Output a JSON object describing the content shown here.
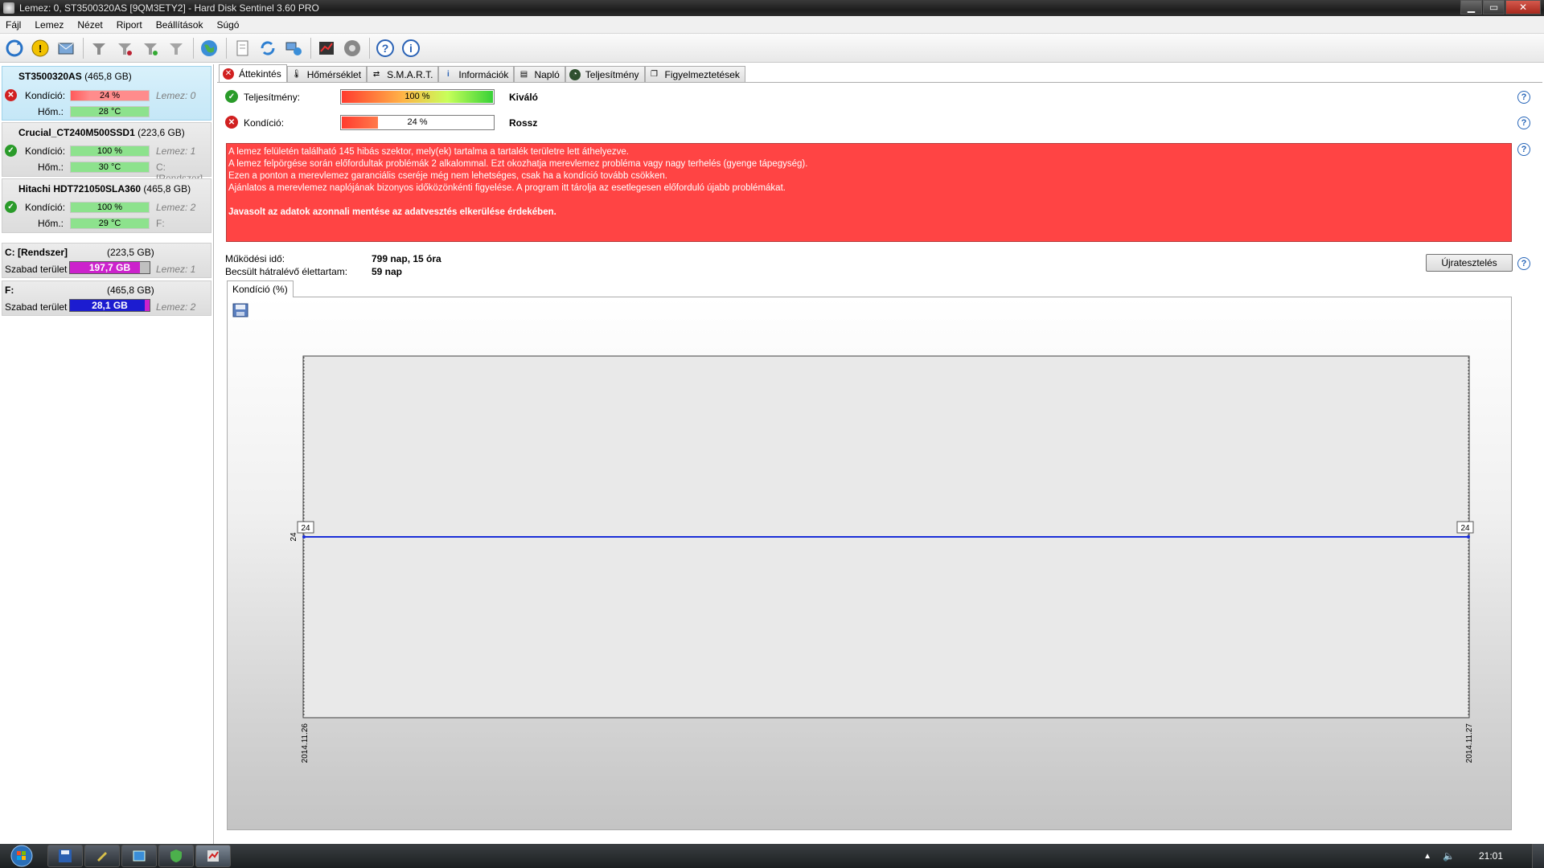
{
  "window": {
    "title": "Lemez: 0, ST3500320AS [9QM3ETY2]  -  Hard Disk Sentinel 3.60 PRO"
  },
  "menu": [
    "Fájl",
    "Lemez",
    "Nézet",
    "Riport",
    "Beállítások",
    "Súgó"
  ],
  "disks": [
    {
      "name": "ST3500320AS",
      "size": "(465,8 GB)",
      "status": "bad",
      "kond_label": "Kondíció:",
      "kond_value": "24 %",
      "kond_pct": 24,
      "temp_label": "Hőm.:",
      "temp_value": "28 °C",
      "disk_index": "Lemez: 0",
      "drive_letter": ""
    },
    {
      "name": "Crucial_CT240M500SSD1",
      "size": "(223,6 GB)",
      "status": "good",
      "kond_label": "Kondíció:",
      "kond_value": "100 %",
      "kond_pct": 100,
      "temp_label": "Hőm.:",
      "temp_value": "30 °C",
      "disk_index": "Lemez: 1",
      "drive_letter": "C: [Rendszer]"
    },
    {
      "name": "Hitachi HDT721050SLA360",
      "size": "(465,8 GB)",
      "status": "good",
      "kond_label": "Kondíció:",
      "kond_value": "100 %",
      "kond_pct": 100,
      "temp_label": "Hőm.:",
      "temp_value": "29 °C",
      "disk_index": "Lemez: 2",
      "drive_letter": "F:"
    }
  ],
  "volumes": [
    {
      "name": "C: [Rendszer]",
      "size": "(223,5 GB)",
      "free_label": "Szabad terület",
      "free_value": "197,7 GB",
      "free_pct": 88,
      "fill_color": "#cc22cc",
      "disk": "Lemez: 1"
    },
    {
      "name": "F:",
      "size": "(465,8 GB)",
      "free_label": "Szabad terület",
      "free_value": "28,1 GB",
      "free_pct": 6,
      "fill_color": "#1c1cd0",
      "disk": "Lemez: 2"
    }
  ],
  "tabs": [
    "Áttekintés",
    "Hőmérséklet",
    "S.M.A.R.T.",
    "Információk",
    "Napló",
    "Teljesítmény",
    "Figyelmeztetések"
  ],
  "overview": {
    "performance": {
      "label": "Teljesítmény:",
      "value": "100 %",
      "pct": 100,
      "rating": "Kiváló"
    },
    "health": {
      "label": "Kondíció:",
      "value": "24 %",
      "pct": 24,
      "rating": "Rossz"
    },
    "alert_lines": [
      "A lemez felületén található 145 hibás szektor, mely(ek) tartalma a tartalék területre lett áthelyezve.",
      "A lemez felpörgése során előfordultak problémák 2 alkalommal. Ezt okozhatja merevlemez probléma vagy nagy terhelés (gyenge tápegység).",
      "Ezen a ponton a merevlemez garanciális cseréje még nem lehetséges, csak ha a kondíció tovább csökken.",
      "Ajánlatos a merevlemez naplójának bizonyos időközönkénti figyelése. A program itt tárolja az esetlegesen előforduló újabb problémákat."
    ],
    "alert_bold": "Javasolt az adatok azonnali mentése az adatvesztés elkerülése érdekében.",
    "uptime_label": "Működési idő:",
    "uptime_value": "799 nap, 15 óra",
    "remaining_label": "Becsült hátralévő élettartam:",
    "remaining_value": "59 nap",
    "retest_button": "Újratesztelés",
    "chart_tab": "Kondíció  (%)"
  },
  "chart_data": {
    "type": "line",
    "x": [
      "2014.11.26",
      "2014.11.27"
    ],
    "series": [
      {
        "values": [
          24,
          24
        ],
        "color": "#1a2fd8"
      }
    ],
    "point_labels": [
      "24",
      "24"
    ],
    "y_tick": "24",
    "ylim": [
      0,
      48
    ],
    "grid": false
  },
  "taskbar": {
    "clock": "21:01"
  },
  "colors": {
    "alert_bg": "#ff4444",
    "good": "#2a9b2a",
    "bad": "#d12020",
    "selected_bg": "#d9f1fb"
  }
}
